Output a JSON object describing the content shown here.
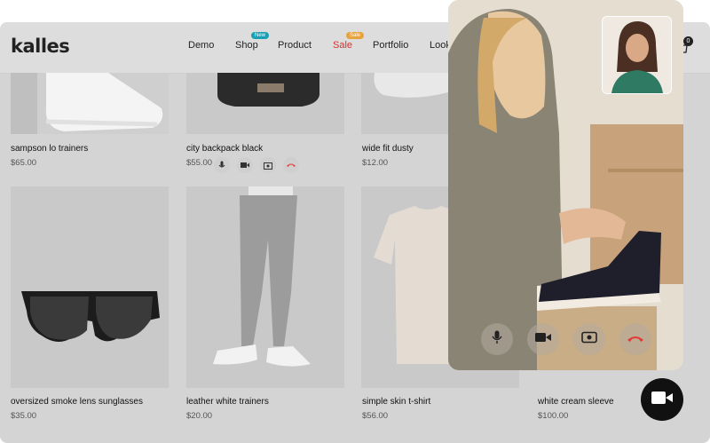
{
  "site": {
    "logo": "kalles"
  },
  "nav": [
    {
      "label": "Demo"
    },
    {
      "label": "Shop",
      "badge": "New",
      "badge_color": "#1a9fb5"
    },
    {
      "label": "Product"
    },
    {
      "label": "Sale",
      "badge": "Sale",
      "badge_color": "#e8a33a",
      "color": "#d9302c"
    },
    {
      "label": "Portfolio"
    },
    {
      "label": "Look"
    }
  ],
  "cart": {
    "count": "0"
  },
  "products_row1": [
    {
      "name": "sampson lo trainers",
      "price": "$65.00"
    },
    {
      "name": "city backpack black",
      "price": "$55.00"
    },
    {
      "name": "wide fit dusty",
      "price": "$12.00"
    }
  ],
  "products_row2": [
    {
      "name": "oversized smoke lens sunglasses",
      "price": "$35.00"
    },
    {
      "name": "leather white trainers",
      "price": "$20.00"
    },
    {
      "name": "simple skin t-shirt",
      "price": "$56.00"
    },
    {
      "name": "white cream sleeve",
      "price": "$100.00"
    }
  ],
  "call_controls": [
    "microphone-icon",
    "video-camera-icon",
    "switch-camera-icon",
    "end-call-icon"
  ],
  "colors": {
    "end_call": "#e53935",
    "fab": "#111111"
  }
}
